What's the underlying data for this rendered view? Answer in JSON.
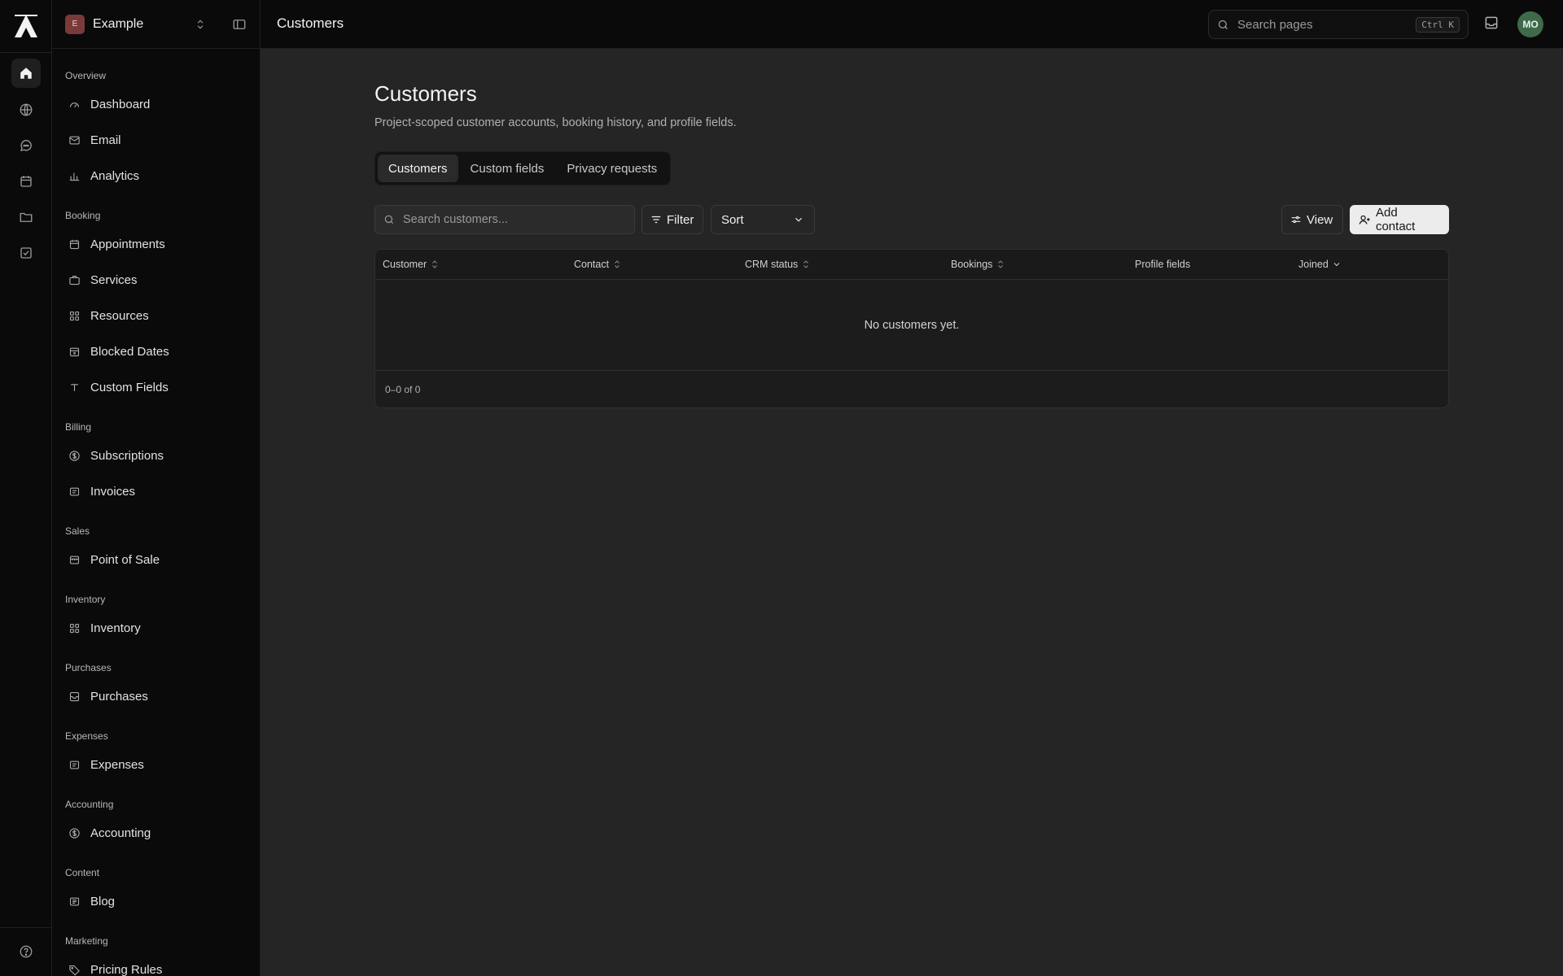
{
  "project": {
    "initial": "E",
    "name": "Example"
  },
  "header": {
    "title": "Customers",
    "search_placeholder": "Search pages",
    "shortcut": "Ctrl K",
    "avatar_initials": "MO"
  },
  "rail": [
    "home-icon",
    "globe-icon",
    "chat-icon",
    "calendar-icon",
    "folder-icon",
    "checkbox-icon"
  ],
  "sidebar": {
    "sections": [
      {
        "label": "Overview",
        "items": [
          {
            "label": "Dashboard",
            "icon": "gauge-icon"
          },
          {
            "label": "Email",
            "icon": "mail-icon"
          },
          {
            "label": "Analytics",
            "icon": "bar-chart-icon"
          }
        ]
      },
      {
        "label": "Booking",
        "items": [
          {
            "label": "Appointments",
            "icon": "calendar-icon"
          },
          {
            "label": "Services",
            "icon": "briefcase-icon"
          },
          {
            "label": "Resources",
            "icon": "grid-icon"
          },
          {
            "label": "Blocked Dates",
            "icon": "calendar-x-icon"
          },
          {
            "label": "Custom Fields",
            "icon": "type-icon"
          }
        ]
      },
      {
        "label": "Billing",
        "items": [
          {
            "label": "Subscriptions",
            "icon": "dollar-circle-icon"
          },
          {
            "label": "Invoices",
            "icon": "receipt-icon"
          }
        ]
      },
      {
        "label": "Sales",
        "items": [
          {
            "label": "Point of Sale",
            "icon": "store-icon"
          }
        ]
      },
      {
        "label": "Inventory",
        "items": [
          {
            "label": "Inventory",
            "icon": "grid-icon"
          }
        ]
      },
      {
        "label": "Purchases",
        "items": [
          {
            "label": "Purchases",
            "icon": "inbox-icon"
          }
        ]
      },
      {
        "label": "Expenses",
        "items": [
          {
            "label": "Expenses",
            "icon": "receipt-icon"
          }
        ]
      },
      {
        "label": "Accounting",
        "items": [
          {
            "label": "Accounting",
            "icon": "dollar-circle-icon"
          }
        ]
      },
      {
        "label": "Content",
        "items": [
          {
            "label": "Blog",
            "icon": "newspaper-icon"
          }
        ]
      },
      {
        "label": "Marketing",
        "items": [
          {
            "label": "Pricing Rules",
            "icon": "tag-icon"
          }
        ]
      }
    ]
  },
  "page": {
    "title": "Customers",
    "subtitle": "Project-scoped customer accounts, booking history, and profile fields.",
    "tabs": [
      {
        "label": "Customers",
        "active": true
      },
      {
        "label": "Custom fields",
        "active": false
      },
      {
        "label": "Privacy requests",
        "active": false
      }
    ]
  },
  "toolbar": {
    "search_placeholder": "Search customers...",
    "filter_label": "Filter",
    "sort_label": "Sort",
    "view_label": "View",
    "add_label": "Add contact"
  },
  "table": {
    "columns": [
      {
        "label": "Customer",
        "sort": "both"
      },
      {
        "label": "Contact",
        "sort": "both"
      },
      {
        "label": "CRM status",
        "sort": "both"
      },
      {
        "label": "Bookings",
        "sort": "both"
      },
      {
        "label": "Profile fields",
        "sort": "none"
      },
      {
        "label": "Joined",
        "sort": "desc"
      }
    ],
    "empty_message": "No customers yet.",
    "pagination": "0–0 of 0"
  }
}
